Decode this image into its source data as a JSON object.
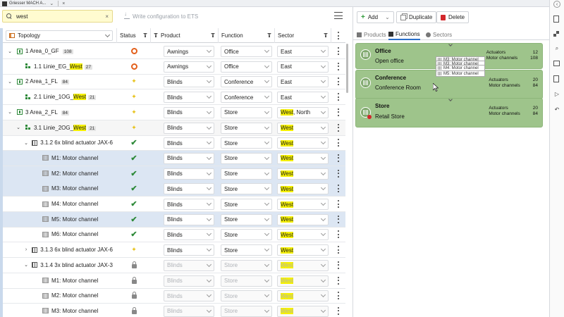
{
  "window": {
    "title": "Griesser MACH A...",
    "tab_close": "×"
  },
  "search": {
    "value": "west",
    "placeholder": "",
    "clear": "×"
  },
  "toolbar": {
    "write_label": "Write configuration to ETS"
  },
  "table": {
    "headers": {
      "topology": "Topology",
      "status": "Status",
      "product": "Product",
      "function": "Function",
      "sector": "Sector"
    },
    "rows": [
      {
        "indent": 0,
        "exp": "⌄",
        "icon": "area",
        "pre": "1 Area_0_GF ",
        "hl": "",
        "post": "",
        "badge": "108",
        "status": "ring",
        "product": "Awnings",
        "function": "Office",
        "sector_pre": "East",
        "sector_hl": "",
        "sector_post": "",
        "dis": false,
        "sel": false,
        "grp": false
      },
      {
        "indent": 1,
        "exp": "",
        "icon": "line",
        "pre": "1.1 Linie_EG_",
        "hl": "West",
        "post": "",
        "badge": "27",
        "status": "ring",
        "product": "Awnings",
        "function": "Office",
        "sector_pre": "East",
        "sector_hl": "",
        "sector_post": "",
        "dis": false,
        "sel": false,
        "grp": false
      },
      {
        "indent": 0,
        "exp": "⌄",
        "icon": "area",
        "pre": "2 Area_1_FL ",
        "hl": "",
        "post": "",
        "badge": "84",
        "status": "spark",
        "product": "Blinds",
        "function": "Conference",
        "sector_pre": "East",
        "sector_hl": "",
        "sector_post": "",
        "dis": false,
        "sel": false,
        "grp": false
      },
      {
        "indent": 1,
        "exp": "",
        "icon": "line",
        "pre": "2.1 Linie_1OG_",
        "hl": "West",
        "post": "",
        "badge": "21",
        "status": "spark",
        "product": "Blinds",
        "function": "Conference",
        "sector_pre": "East",
        "sector_hl": "",
        "sector_post": "",
        "dis": false,
        "sel": false,
        "grp": false
      },
      {
        "indent": 0,
        "exp": "⌄",
        "icon": "area",
        "pre": "3 Area_2_FL ",
        "hl": "",
        "post": "",
        "badge": "84",
        "status": "spark",
        "product": "Blinds",
        "function": "Store",
        "sector_pre": "",
        "sector_hl": "West",
        "sector_post": ", North",
        "dis": false,
        "sel": false,
        "grp": false
      },
      {
        "indent": 1,
        "exp": "⌄",
        "icon": "line",
        "pre": "3.1 Linie_2OG_",
        "hl": "West",
        "post": "",
        "badge": "21",
        "status": "spark",
        "product": "Blinds",
        "function": "Store",
        "sector_pre": "",
        "sector_hl": "West",
        "sector_post": "",
        "dis": false,
        "sel": false,
        "grp": true
      },
      {
        "indent": 2,
        "exp": "⌄",
        "icon": "act",
        "pre": "3.1.2 6x blind actuator JAX-6",
        "hl": "",
        "post": "",
        "badge": "",
        "status": "check",
        "product": "Blinds",
        "function": "Store",
        "sector_pre": "",
        "sector_hl": "West",
        "sector_post": "",
        "dis": false,
        "sel": false,
        "grp": false
      },
      {
        "indent": 3,
        "exp": "",
        "icon": "ch",
        "pre": "M1: Motor channel",
        "hl": "",
        "post": "",
        "badge": "",
        "status": "check",
        "product": "Blinds",
        "function": "Store",
        "sector_pre": "",
        "sector_hl": "West",
        "sector_post": "",
        "dis": false,
        "sel": true,
        "grp": false
      },
      {
        "indent": 3,
        "exp": "",
        "icon": "ch",
        "pre": "M2: Motor channel",
        "hl": "",
        "post": "",
        "badge": "",
        "status": "check",
        "product": "Blinds",
        "function": "Store",
        "sector_pre": "",
        "sector_hl": "West",
        "sector_post": "",
        "dis": false,
        "sel": true,
        "grp": false
      },
      {
        "indent": 3,
        "exp": "",
        "icon": "ch",
        "pre": "M3: Motor channel",
        "hl": "",
        "post": "",
        "badge": "",
        "status": "check",
        "product": "Blinds",
        "function": "Store",
        "sector_pre": "",
        "sector_hl": "West",
        "sector_post": "",
        "dis": false,
        "sel": true,
        "grp": false
      },
      {
        "indent": 3,
        "exp": "",
        "icon": "ch",
        "pre": "M4: Motor channel",
        "hl": "",
        "post": "",
        "badge": "",
        "status": "check",
        "product": "Blinds",
        "function": "Store",
        "sector_pre": "",
        "sector_hl": "West",
        "sector_post": "",
        "dis": false,
        "sel": false,
        "grp": false
      },
      {
        "indent": 3,
        "exp": "",
        "icon": "ch",
        "pre": "M5: Motor channel",
        "hl": "",
        "post": "",
        "badge": "",
        "status": "check",
        "product": "Blinds",
        "function": "Store",
        "sector_pre": "",
        "sector_hl": "West",
        "sector_post": "",
        "dis": false,
        "sel": true,
        "grp": false
      },
      {
        "indent": 3,
        "exp": "",
        "icon": "ch",
        "pre": "M6: Motor channel",
        "hl": "",
        "post": "",
        "badge": "",
        "status": "check",
        "product": "Blinds",
        "function": "Store",
        "sector_pre": "",
        "sector_hl": "West",
        "sector_post": "",
        "dis": false,
        "sel": false,
        "grp": false
      },
      {
        "indent": 2,
        "exp": "›",
        "icon": "act",
        "pre": "3.1.3 6x blind actuator JAX-6",
        "hl": "",
        "post": "",
        "badge": "",
        "status": "spark",
        "product": "Blinds",
        "function": "Store",
        "sector_pre": "",
        "sector_hl": "West",
        "sector_post": "",
        "dis": false,
        "sel": false,
        "grp": false
      },
      {
        "indent": 2,
        "exp": "⌄",
        "icon": "act",
        "pre": "3.1.4 3x blind actuator JAX-3",
        "hl": "",
        "post": "",
        "badge": "",
        "status": "lock",
        "product": "Blinds",
        "function": "Store",
        "sector_pre": "",
        "sector_hl": "West",
        "sector_post": "",
        "dis": true,
        "sel": false,
        "grp": false
      },
      {
        "indent": 3,
        "exp": "",
        "icon": "ch",
        "pre": "M1: Motor channel",
        "hl": "",
        "post": "",
        "badge": "",
        "status": "lock",
        "product": "Blinds",
        "function": "Store",
        "sector_pre": "",
        "sector_hl": "West",
        "sector_post": "",
        "dis": true,
        "sel": false,
        "grp": false
      },
      {
        "indent": 3,
        "exp": "",
        "icon": "ch",
        "pre": "M2: Motor channel",
        "hl": "",
        "post": "",
        "badge": "",
        "status": "lock",
        "product": "Blinds",
        "function": "Store",
        "sector_pre": "",
        "sector_hl": "West",
        "sector_post": "",
        "dis": true,
        "sel": false,
        "grp": false
      },
      {
        "indent": 3,
        "exp": "",
        "icon": "ch",
        "pre": "M3: Motor channel",
        "hl": "",
        "post": "",
        "badge": "",
        "status": "lock",
        "product": "Blinds",
        "function": "Store",
        "sector_pre": "",
        "sector_hl": "West",
        "sector_post": "",
        "dis": true,
        "sel": false,
        "grp": false
      }
    ]
  },
  "right": {
    "buttons": {
      "add": "Add",
      "duplicate": "Duplicate",
      "delete": "Delete"
    },
    "tabs": {
      "products": "Products",
      "functions": "Functions",
      "sectors": "Sectors"
    },
    "cards": [
      {
        "title": "Office",
        "subtitle": "Open office",
        "actuators_label": "Actuators",
        "actuators": "12",
        "channels_label": "Motor channels",
        "channels": "108"
      },
      {
        "title": "Conference",
        "subtitle": "Conference Room",
        "actuators_label": "Actuators",
        "actuators": "20",
        "channels_label": "Motor channels",
        "channels": "84"
      },
      {
        "title": "Store",
        "subtitle": "Retail Store",
        "actuators_label": "Actuators",
        "actuators": "20",
        "channels_label": "Motor channels",
        "channels": "84"
      }
    ],
    "drag_items": [
      "M3: Motor channel",
      "M3: Motor channel",
      "M4: Motor channel",
      "M5: Motor channel"
    ]
  },
  "colors": {
    "highlight": "#f5f000",
    "card": "#9ec48b",
    "selected_row": "#dce6f3",
    "accent": "#2a6fc9",
    "delete": "#d2262b"
  }
}
